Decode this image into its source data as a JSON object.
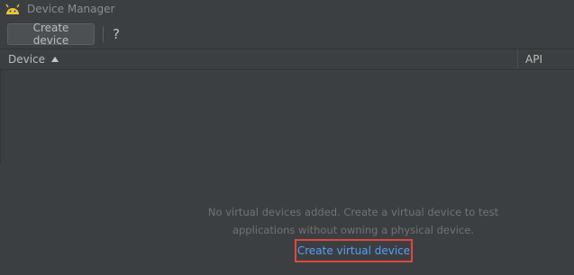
{
  "window": {
    "title": "Device Manager",
    "app_icon": "android-icon",
    "accent_color": "#a4c639"
  },
  "toolbar": {
    "create_device_label": "Create device",
    "help_label": "?"
  },
  "table": {
    "columns": [
      {
        "label": "Device",
        "sort": "ascending"
      },
      {
        "label": "API"
      }
    ],
    "rows": []
  },
  "empty_state": {
    "message": "No virtual devices added. Create a virtual device to test applications without owning a physical device.",
    "link_label": "Create virtual device",
    "link_color": "#589df6",
    "highlight_color": "#e0473f"
  }
}
